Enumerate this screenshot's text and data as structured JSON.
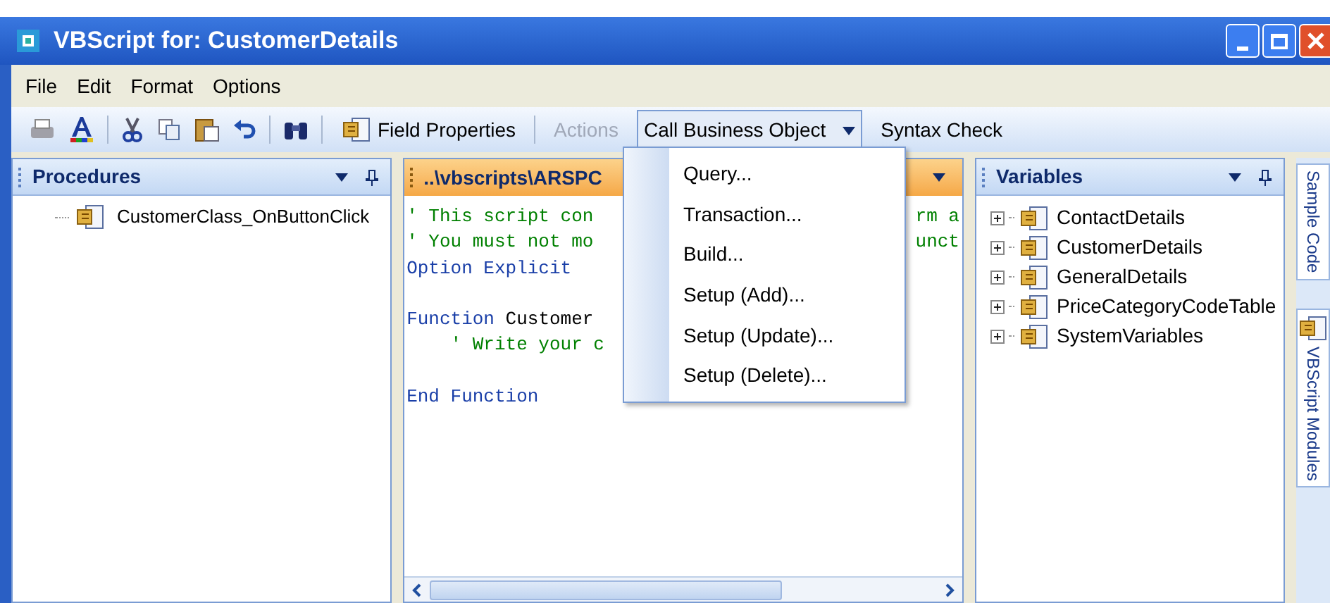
{
  "window": {
    "title": "VBScript for: CustomerDetails"
  },
  "menu_bar": [
    "File",
    "Edit",
    "Format",
    "Options"
  ],
  "toolbar": {
    "buttons": [
      {
        "label": "Field Properties",
        "disabled": false,
        "expanded": false,
        "dropdown": false
      },
      {
        "label": "Actions",
        "disabled": true,
        "expanded": false,
        "dropdown": false
      },
      {
        "label": "Call Business Object",
        "disabled": false,
        "expanded": true,
        "dropdown": true
      },
      {
        "label": "Syntax Check",
        "disabled": false,
        "expanded": false,
        "dropdown": false
      }
    ]
  },
  "dropdown_menu": [
    "Query...",
    "Transaction...",
    "Build...",
    "Setup (Add)...",
    "Setup (Update)...",
    "Setup (Delete)..."
  ],
  "procedures": {
    "title": "Procedures",
    "items": [
      "CustomerClass_OnButtonClick"
    ]
  },
  "editor": {
    "tab": "..\\vbscripts\\ARSPC",
    "lines": [
      {
        "segments": [
          {
            "kind": "comment",
            "text": "' This script con"
          }
        ],
        "tail": {
          "kind": "comment",
          "text": "rm a"
        }
      },
      {
        "segments": [
          {
            "kind": "comment",
            "text": "' You must not mo"
          }
        ],
        "tail": {
          "kind": "comment",
          "text": "unct"
        }
      },
      {
        "segments": [
          {
            "kind": "keyword",
            "text": "Option Explicit"
          }
        ]
      },
      {
        "kind": "blank"
      },
      {
        "segments": [
          {
            "kind": "keyword",
            "text": "Function"
          },
          {
            "kind": "plain",
            "text": " Customer"
          }
        ]
      },
      {
        "segments": [
          {
            "kind": "comment",
            "text": "    ' Write your c"
          }
        ]
      },
      {
        "kind": "blank"
      },
      {
        "segments": [
          {
            "kind": "keyword",
            "text": "End Function"
          }
        ]
      }
    ]
  },
  "variables": {
    "title": "Variables",
    "items": [
      {
        "label": "ContactDetails",
        "expanded": false
      },
      {
        "label": "CustomerDetails",
        "expanded": false
      },
      {
        "label": "GeneralDetails",
        "expanded": false
      },
      {
        "label": "PriceCategoryCodeTable",
        "expanded": false
      },
      {
        "label": "SystemVariables",
        "expanded": false
      }
    ]
  },
  "side_tabs": [
    "Sample Code",
    "VBScript Modules"
  ]
}
